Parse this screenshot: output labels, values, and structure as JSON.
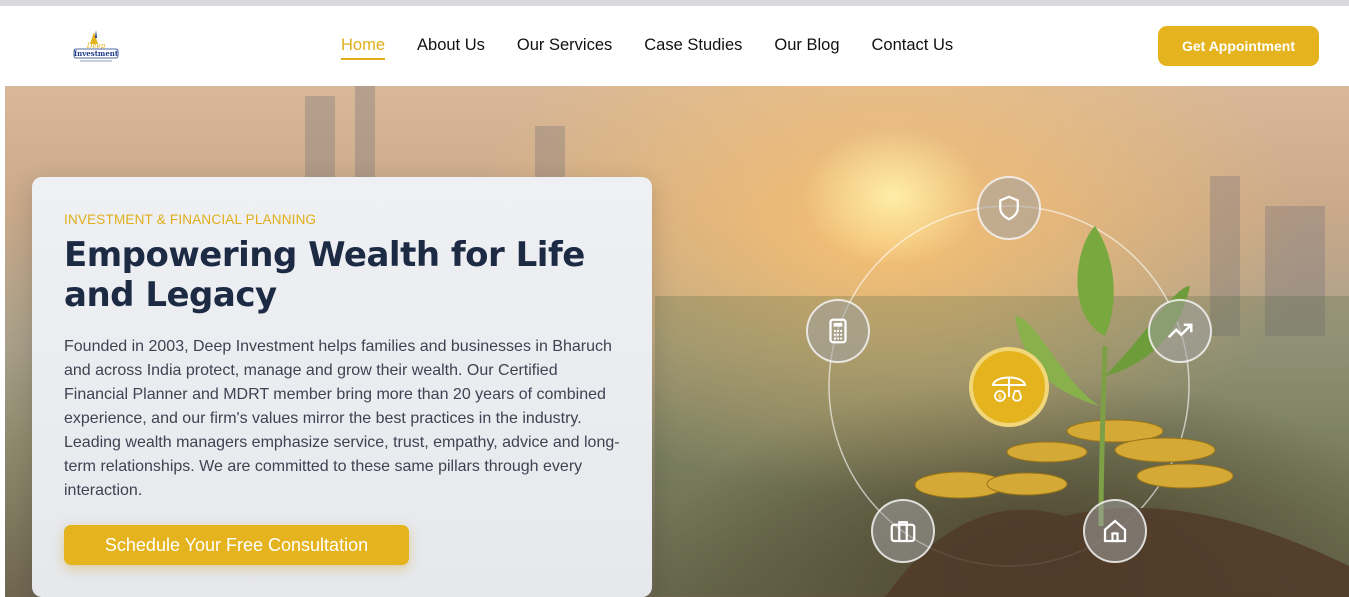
{
  "header": {
    "logo_alt": "Deep Investment",
    "nav": [
      {
        "label": "Home",
        "active": true
      },
      {
        "label": "About Us",
        "active": false
      },
      {
        "label": "Our Services",
        "active": false
      },
      {
        "label": "Case Studies",
        "active": false
      },
      {
        "label": "Our Blog",
        "active": false
      },
      {
        "label": "Contact Us",
        "active": false
      }
    ],
    "cta_label": "Get Appointment"
  },
  "hero": {
    "eyebrow": "INVESTMENT & FINANCIAL PLANNING",
    "headline": "Empowering Wealth for Life and Legacy",
    "description": "Founded in 2003, Deep Investment helps families and businesses in Bharuch and across India protect, manage and grow their wealth. Our Certified Financial Planner and MDRT member bring more than 20 years of combined experience, and our firm's values mirror the best practices in the industry. Leading wealth managers emphasize service, trust, empathy, advice and long-term relationships. We are committed to these same pillars through every interaction.",
    "cta_label": "Schedule Your Free Consultation"
  },
  "icons": {
    "shield": "shield-icon",
    "calculator": "calculator-icon",
    "trending": "trending-up-icon",
    "center": "umbrella-money-icon",
    "briefcase": "briefcase-icon",
    "home": "home-icon"
  },
  "colors": {
    "accent": "#e4b31d",
    "heading": "#1d2a44",
    "body": "#3d4352"
  }
}
